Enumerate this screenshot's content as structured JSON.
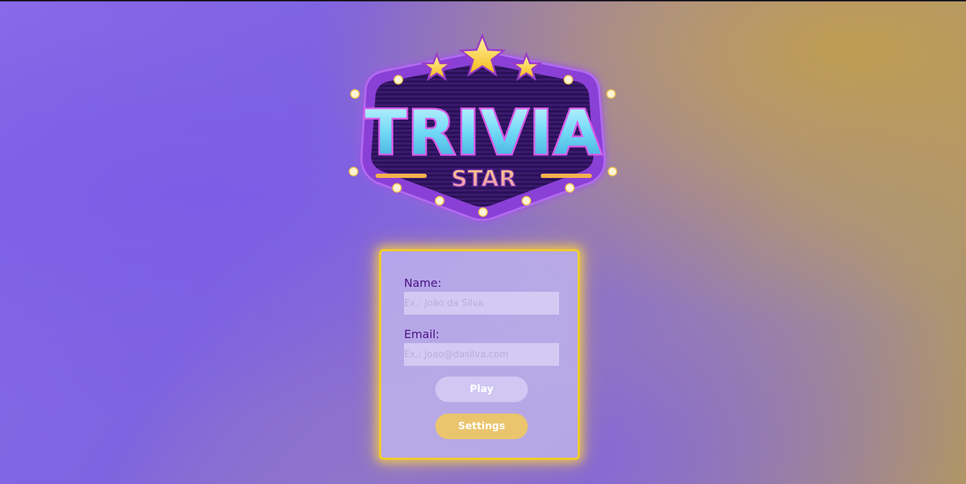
{
  "logo": {
    "title_text": "TRIVIA",
    "subtitle_text": "STAR"
  },
  "form": {
    "name": {
      "label": "Name:",
      "placeholder": "Ex.: João da Silva",
      "value": ""
    },
    "email": {
      "label": "Email:",
      "placeholder": "Ex.: joao@dasilva.com",
      "value": ""
    },
    "play_label": "Play",
    "settings_label": "Settings"
  },
  "colors": {
    "card_border": "#f2cc2a",
    "label_text": "#4a1182",
    "settings_button": "#eac56e",
    "logo_letters": "#6fd8f5",
    "logo_subtitle": "#f5b24a"
  }
}
